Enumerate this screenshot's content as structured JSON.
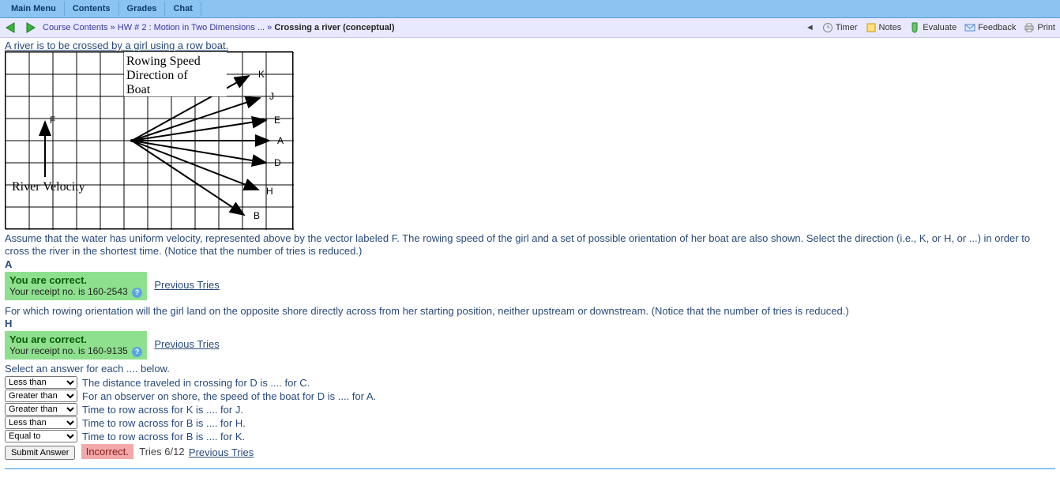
{
  "menu": {
    "main": "Main Menu",
    "contents": "Contents",
    "grades": "Grades",
    "chat": "Chat"
  },
  "breadcrumb": {
    "course": "Course Contents",
    "sep": " » ",
    "hw": "HW # 2 : Motion in Two Dimensions ...",
    "current": "Crossing a river (conceptual)"
  },
  "tools": {
    "timer": "Timer",
    "notes": "Notes",
    "evaluate": "Evaluate",
    "feedback": "Feedback",
    "print": "Print",
    "back_tri": "◄"
  },
  "intro": "A river is to be crossed by a girl using a row boat.",
  "figure": {
    "rowing": "Rowing Speed",
    "direction": "Direction of",
    "boat": "Boat",
    "river": "River Velocity",
    "F": "F",
    "K": "K",
    "J": "J",
    "E": "E",
    "A": "A",
    "D": "D",
    "H": "H",
    "B": "B"
  },
  "q1": {
    "text": "Assume that the water has uniform velocity, represented above by the vector labeled F. The rowing speed of the girl and a set of possible orientation of her boat are also shown. Select the direction (i.e., K, or H, or ...) in order to cross the river in the shortest time. (Notice that the number of tries is reduced.)",
    "answer": "A",
    "correct": "You are correct.",
    "receipt": "Your receipt no. is 160-2543",
    "prev": "Previous Tries"
  },
  "q2": {
    "text": "For which rowing orientation will the girl land on the opposite shore directly across from her starting position, neither upstream or downstream. (Notice that the number of tries is reduced.)",
    "answer": "H",
    "correct": "You are correct.",
    "receipt": "Your receipt no. is 160-9135",
    "prev": "Previous Tries"
  },
  "q3": {
    "intro": "Select an answer for each .... below.",
    "options": [
      "Less than",
      "Greater than",
      "Equal to"
    ],
    "rows": [
      {
        "sel": "Less than",
        "text": "The distance traveled in crossing for D is .... for C."
      },
      {
        "sel": "Greater than",
        "text": "For an observer on shore, the speed of the boat for D is .... for A."
      },
      {
        "sel": "Greater than",
        "text": "Time to row across for K is .... for J."
      },
      {
        "sel": "Less than",
        "text": "Time to row across for B is .... for H."
      },
      {
        "sel": "Equal to",
        "text": "Time to row across for B is .... for K."
      }
    ],
    "submit": "Submit Answer",
    "incorrect": "Incorrect.",
    "tries": "Tries 6/12",
    "prev": "Previous Tries"
  }
}
